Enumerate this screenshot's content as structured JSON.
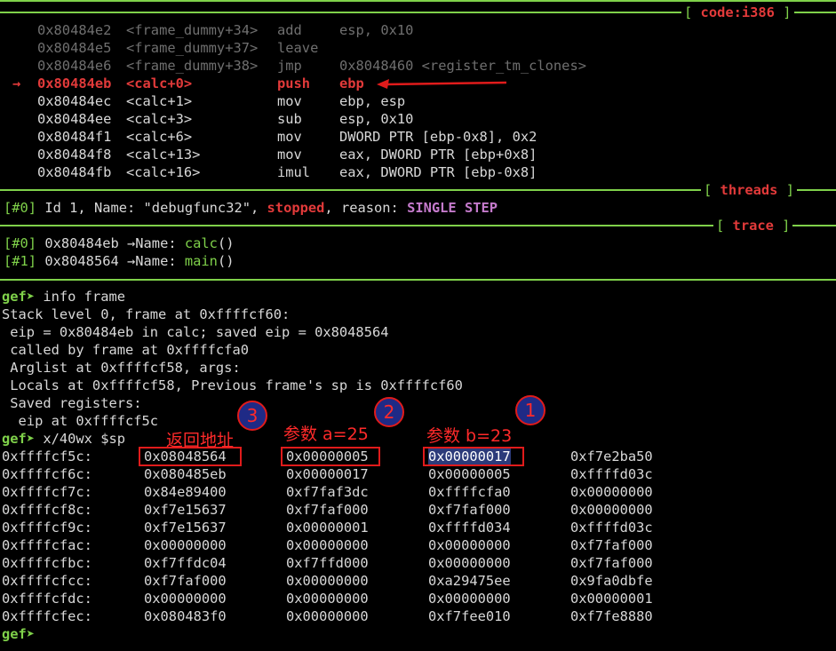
{
  "panes": {
    "code_label": "code:i386",
    "threads_label": "threads",
    "trace_label": "trace"
  },
  "code": {
    "current_marker": "→",
    "rows": [
      {
        "addr": "0x80484e2",
        "sym": "<frame_dummy+34>",
        "op": "add",
        "args": "esp, 0x10"
      },
      {
        "addr": "0x80484e5",
        "sym": "<frame_dummy+37>",
        "op": "leave",
        "args": ""
      },
      {
        "addr": "0x80484e6",
        "sym": "<frame_dummy+38>",
        "op": "jmp",
        "args": "0x8048460 <register_tm_clones>"
      },
      {
        "addr": "0x80484eb",
        "sym": "<calc+0>",
        "op": "push",
        "args": "ebp"
      },
      {
        "addr": "0x80484ec",
        "sym": "<calc+1>",
        "op": "mov",
        "args": "ebp, esp"
      },
      {
        "addr": "0x80484ee",
        "sym": "<calc+3>",
        "op": "sub",
        "args": "esp, 0x10"
      },
      {
        "addr": "0x80484f1",
        "sym": "<calc+6>",
        "op": "mov",
        "args": "DWORD PTR [ebp-0x8], 0x2"
      },
      {
        "addr": "0x80484f8",
        "sym": "<calc+13>",
        "op": "mov",
        "args": "eax, DWORD PTR [ebp+0x8]"
      },
      {
        "addr": "0x80484fb",
        "sym": "<calc+16>",
        "op": "imul",
        "args": "eax, DWORD PTR [ebp-0x8]"
      }
    ]
  },
  "threads": {
    "idx": "[#0]",
    "text1": " Id 1, Name: \"debugfunc32\", ",
    "state": "stopped",
    "text2": ", reason: ",
    "reason": "SINGLE STEP"
  },
  "trace": [
    {
      "idx": "[#0]",
      "addr": " 0x80484eb →Name: ",
      "fn": "calc",
      "tail": "()"
    },
    {
      "idx": "[#1]",
      "addr": " 0x8048564 →Name: ",
      "fn": "main",
      "tail": "()"
    }
  ],
  "console": {
    "prompt": "gef➤",
    "cmd1": " info frame",
    "out": [
      "Stack level 0, frame at 0xffffcf60:",
      " eip = 0x80484eb in calc; saved eip = 0x8048564",
      " called by frame at 0xffffcfa0",
      " Arglist at 0xffffcf58, args:",
      " Locals at 0xffffcf58, Previous frame's sp is 0xffffcf60",
      " Saved registers:",
      "  eip at 0xffffcf5c"
    ],
    "cmd2": " x/40wx $sp"
  },
  "memory": [
    {
      "addr": "0xffffcf5c:",
      "w": [
        "0x08048564",
        "0x00000005",
        "0x00000017",
        "0xf7e2ba50"
      ]
    },
    {
      "addr": "0xffffcf6c:",
      "w": [
        "0x080485eb",
        "0x00000017",
        "0x00000005",
        "0xffffd03c"
      ]
    },
    {
      "addr": "0xffffcf7c:",
      "w": [
        "0x84e89400",
        "0xf7faf3dc",
        "0xffffcfa0",
        "0x00000000"
      ]
    },
    {
      "addr": "0xffffcf8c:",
      "w": [
        "0xf7e15637",
        "0xf7faf000",
        "0xf7faf000",
        "0x00000000"
      ]
    },
    {
      "addr": "0xffffcf9c:",
      "w": [
        "0xf7e15637",
        "0x00000001",
        "0xffffd034",
        "0xffffd03c"
      ]
    },
    {
      "addr": "0xffffcfac:",
      "w": [
        "0x00000000",
        "0x00000000",
        "0x00000000",
        "0xf7faf000"
      ]
    },
    {
      "addr": "0xffffcfbc:",
      "w": [
        "0xf7ffdc04",
        "0xf7ffd000",
        "0x00000000",
        "0xf7faf000"
      ]
    },
    {
      "addr": "0xffffcfcc:",
      "w": [
        "0xf7faf000",
        "0x00000000",
        "0xa29475ee",
        "0x9fa0dbfe"
      ]
    },
    {
      "addr": "0xffffcfdc:",
      "w": [
        "0x00000000",
        "0x00000000",
        "0x00000000",
        "0x00000001"
      ]
    },
    {
      "addr": "0xffffcfec:",
      "w": [
        "0x080483f0",
        "0x00000000",
        "0xf7fee010",
        "0xf7fe8880"
      ]
    }
  ],
  "annotations": {
    "ret_label": "返回地址",
    "arg_a_label": "参数 a=25",
    "arg_b_label": "参数 b=23",
    "n1": "1",
    "n2": "2",
    "n3": "3"
  }
}
